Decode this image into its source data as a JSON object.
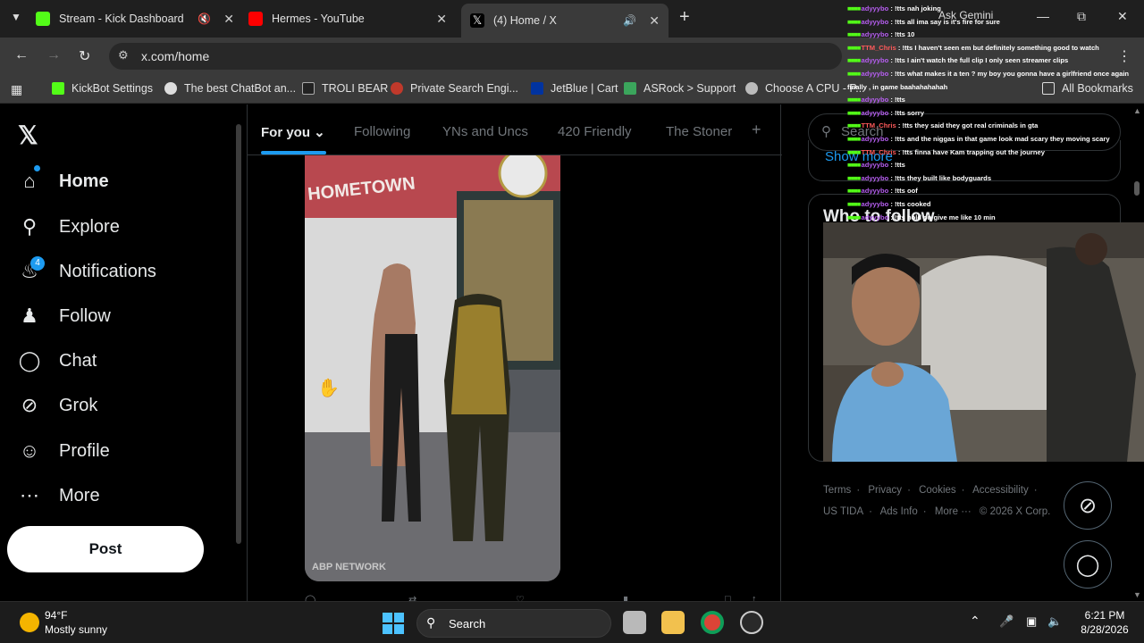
{
  "browser": {
    "tabs": [
      {
        "title": "Stream - Kick Dashboard",
        "muted": true,
        "icon": "kick-icon"
      },
      {
        "title": "Hermes - YouTube",
        "icon": "youtube-icon"
      },
      {
        "title": "(4) Home / X",
        "audible": true,
        "active": true,
        "icon": "x-icon"
      }
    ],
    "url": "x.com/home",
    "ask_gemini": "Ask Gemini",
    "bookmarks": [
      "KickBot Settings",
      "The best ChatBot an...",
      "TROLI BEAR",
      "Private Search Engi...",
      "JetBlue | Cart",
      "ASRock > Support",
      "Choose A CPU - P..."
    ],
    "all_bookmarks": "All Bookmarks"
  },
  "x": {
    "nav": [
      {
        "label": "Home",
        "icon": "home-icon"
      },
      {
        "label": "Explore",
        "icon": "search-icon"
      },
      {
        "label": "Notifications",
        "icon": "bell-icon"
      },
      {
        "label": "Follow",
        "icon": "add-person-icon"
      },
      {
        "label": "Chat",
        "icon": "chat-bubble-icon"
      },
      {
        "label": "Grok",
        "icon": "grok-icon"
      },
      {
        "label": "Profile",
        "icon": "person-icon"
      },
      {
        "label": "More",
        "icon": "more-circle-icon"
      }
    ],
    "notifications_count": "4",
    "post_label": "Post",
    "feed_tabs": [
      "For you",
      "Following",
      "YNs and Uncs",
      "420 Friendly",
      "The Stoner"
    ],
    "video_sign": "HOMETOWN",
    "video_watermark": "ABP NETWORK",
    "search_placeholder": "Search",
    "show_more": "Show more",
    "who_to_follow": "Who to follow",
    "footer": [
      "Terms",
      "Privacy",
      "Cookies",
      "Accessibility",
      "US TIDA",
      "Ads Info",
      "More ···",
      "© 2026 X Corp."
    ],
    "accent": "#1d9bf0"
  },
  "chat": [
    {
      "user": "adyyybo",
      "msg": "!tts nah joking"
    },
    {
      "user": "adyyybo",
      "msg": "!tts all ima say is it's fire for sure"
    },
    {
      "user": "adyyybo",
      "msg": "!tts 10"
    },
    {
      "user": "TTM_Chris",
      "msg": "!tts I haven't seen em but definitely something good to watch"
    },
    {
      "user": "adyyybo",
      "msg": "!tts I ain't watch the full clip I only seen streamer clips"
    },
    {
      "user": "adyyybo",
      "msg": "!tts what makes it a ten ? my boy you gonna have a girlfriend once again"
    },
    {
      "user": "",
      "msg": "finally , in game baahahahahah"
    },
    {
      "user": "adyyybo",
      "msg": "!tts"
    },
    {
      "user": "adyyybo",
      "msg": "!tts sorry"
    },
    {
      "user": "TTM_Chris",
      "msg": "!tts they said they got real criminals in gta"
    },
    {
      "user": "adyyybo",
      "msg": "!tts and the niggas in that game look mad scary they moving scary"
    },
    {
      "user": "TTM_Chris",
      "msg": "!tts finna have Kam trapping out the journey"
    },
    {
      "user": "adyyybo",
      "msg": "!tts"
    },
    {
      "user": "adyyybo",
      "msg": "!tts they built like bodyguards"
    },
    {
      "user": "adyyybo",
      "msg": "!tts oof"
    },
    {
      "user": "adyyybo",
      "msg": "!tts cooked"
    },
    {
      "user": "adyyybo",
      "msg": "!tts hold on give me like 10 min"
    }
  ],
  "taskbar": {
    "temp": "94°F",
    "weather": "Mostly sunny",
    "search_label": "Search",
    "time": "6:21 PM",
    "date": "8/28/2026"
  }
}
